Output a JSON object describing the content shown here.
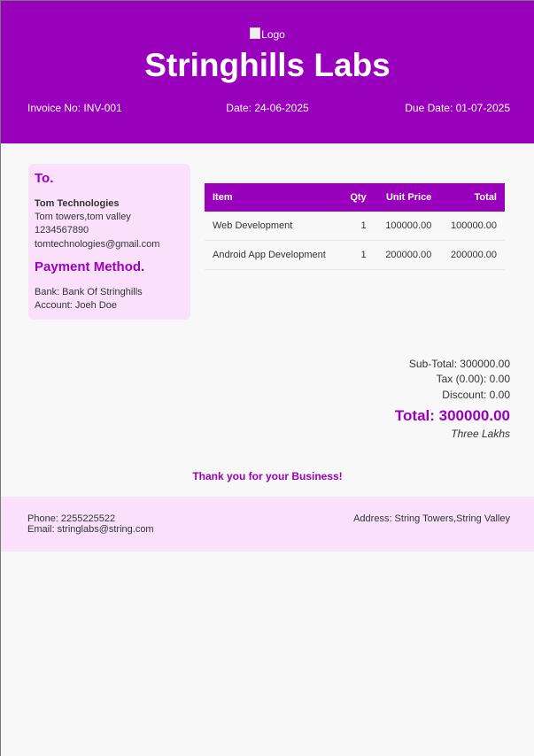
{
  "header": {
    "logo_alt": "Logo",
    "company": "Stringhills Labs",
    "invoice_no": "Invoice No: INV-001",
    "date": "Date: 24-06-2025",
    "due_date": "Due Date: 01-07-2025",
    "colors": {
      "brand": "#9900bb",
      "card": "#fbe0fb"
    }
  },
  "to": {
    "heading": "To.",
    "name": "Tom Technologies",
    "address": "Tom towers,tom valley",
    "phone": "1234567890",
    "email": "tomtechnologies@gmail.com"
  },
  "payment": {
    "heading": "Payment Method.",
    "bank": "Bank: Bank Of Stringhills",
    "account": "Account: Joeh Doe"
  },
  "table": {
    "headers": [
      "Item",
      "Qty",
      "Unit Price",
      "Total"
    ],
    "rows": [
      [
        "Web Development",
        "1",
        "100000.00",
        "100000.00"
      ],
      [
        "Android App Development",
        "1",
        "200000.00",
        "200000.00"
      ]
    ]
  },
  "summary": {
    "subtotal": "Sub-Total: 300000.00",
    "tax": "Tax (0.00): 0.00",
    "discount": "Discount: 0.00",
    "total": "Total: 300000.00",
    "in_words": "Three Lakhs"
  },
  "thanks": "Thank you for your Business!",
  "footer": {
    "phone": "Phone: 2255225522",
    "email": "Email: stringlabs@string.com",
    "address": "Address: String Towers,String Valley"
  }
}
